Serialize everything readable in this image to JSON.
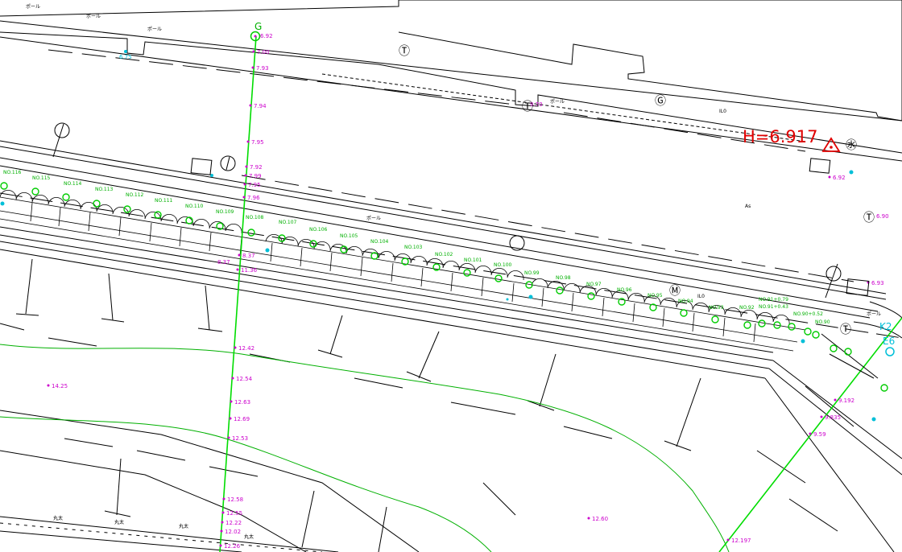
{
  "map": {
    "benchmark": {
      "label": "H=6.917",
      "color": "#e00000"
    },
    "survey_line_main": {
      "label": "G"
    },
    "survey_line_right": {
      "labels": [
        "K2",
        "E6"
      ]
    },
    "symbols": {
      "telephone_marks": [
        "Ⓣ",
        "Ⓣ",
        "Ⓣ",
        "Ⓣ"
      ],
      "gas_mark": "Ⓖ",
      "water_mark": "㊌",
      "manhole_mark": "Ⓜ"
    },
    "texts": {
      "pole_labels": [
        "ポール",
        "ポール",
        "ポール",
        "ポール",
        "ポール",
        "ポール"
      ],
      "il0_labels": [
        "IL0",
        "IL0"
      ],
      "as_label": "As",
      "futo_labels": [
        "丸太",
        "丸太",
        "丸太",
        "丸太"
      ]
    },
    "elevations_main_line": [
      "6.92",
      "7.00",
      "7.93",
      "7.94",
      "7.95",
      "7.92",
      "7.99",
      "7.95",
      "7.96",
      "8.37",
      "8.37",
      "11.36",
      "12.42",
      "12.54",
      "12.63",
      "12.69",
      "12.53",
      "12.58",
      "12.55",
      "12.22",
      "12.02",
      "12.26"
    ],
    "elevations_misc": [
      "14.25",
      "12.60",
      "12.197",
      "9.59",
      "9.835",
      "9.192",
      "6.92",
      "6.93",
      "6.90",
      "9.70",
      "6.75"
    ],
    "station_labels": [
      "NO.116",
      "NO.115",
      "NO.114",
      "NO.113",
      "NO.112",
      "NO.111",
      "NO.110",
      "NO.109",
      "NO.108",
      "NO.107",
      "NO.106",
      "NO.105",
      "NO.104",
      "NO.103",
      "NO.102",
      "NO.101",
      "NO.100",
      "NO.99",
      "NO.98",
      "NO.97",
      "NO.96",
      "NO.95",
      "NO.94",
      "NO.93",
      "NO.92",
      "NO.91+0.79",
      "NO.91+0.43",
      "NO.90+0.52",
      "NO.90"
    ],
    "colors": {
      "linework": "#000000",
      "survey_line": "#00cc00",
      "contour": "#00b000",
      "elevation_points": "#cc00cc",
      "cyan_points": "#00bfd8",
      "benchmark": "#e00000"
    }
  }
}
